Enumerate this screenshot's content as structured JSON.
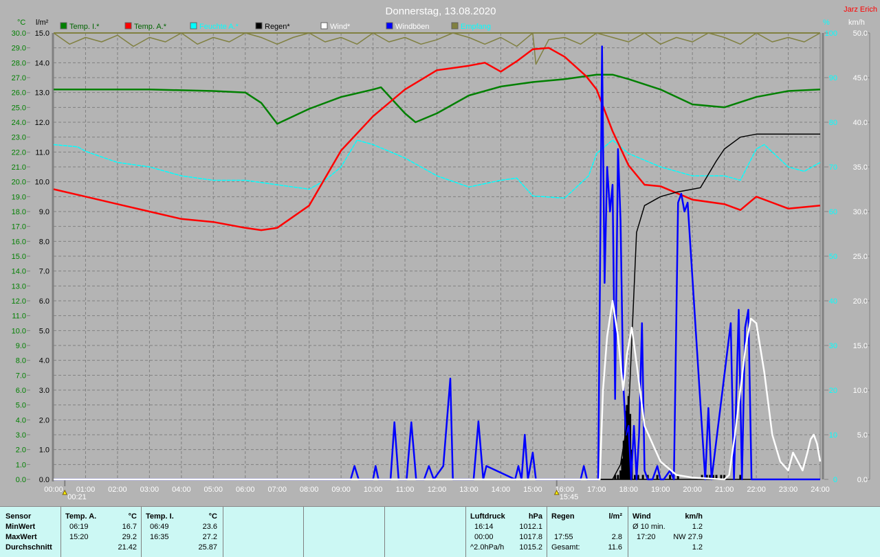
{
  "title": "Donnerstag, 13.08.2020",
  "author": "Jarz Erich",
  "colors": {
    "background": "#b4b4b4",
    "temp_i": "#008000",
    "temp_a": "#ff0000",
    "feuchte": "#00ffff",
    "regen": "#000000",
    "wind": "#ffffff",
    "windboeen": "#0000ff",
    "empfang": "#808040",
    "panel": "#ccf8f4"
  },
  "chart_data": {
    "type": "line",
    "title": "Donnerstag, 13.08.2020",
    "axes": {
      "left_temp": {
        "unit": "°C",
        "range": [
          0,
          30
        ],
        "step": 1
      },
      "left_rain": {
        "unit": "l/m²",
        "range": [
          0,
          15
        ],
        "step": 1
      },
      "right_humidity": {
        "unit": "%",
        "range": [
          0,
          100
        ],
        "step": 10
      },
      "right_wind": {
        "unit": "km/h",
        "range": [
          0,
          50
        ],
        "step": 5
      },
      "x": {
        "unit": "h",
        "range": [
          0,
          24
        ],
        "ticks": [
          "00:00",
          "01:00",
          "02:00",
          "03:00",
          "04:00",
          "05:00",
          "06:00",
          "07:00",
          "08:00",
          "09:00",
          "10:00",
          "11:00",
          "12:00",
          "13:00",
          "14:00",
          "15:00",
          "16:00",
          "17:00",
          "18:00",
          "19:00",
          "20:00",
          "21:00",
          "22:00",
          "23:00",
          "24:00"
        ]
      }
    },
    "grid": true,
    "legend": [
      {
        "label": "Temp. I.*",
        "color": "#008000",
        "text_color": "#006400"
      },
      {
        "label": "Temp. A.*",
        "color": "#ff0000",
        "text_color": "#006400"
      },
      {
        "label": "Feuchte A.*",
        "color": "#00ffff",
        "text_color": "#00ffff"
      },
      {
        "label": "Regen*",
        "color": "#000000",
        "text_color": "#000000"
      },
      {
        "label": "Wind*",
        "color": "#ffffff",
        "text_color": "#ffffff"
      },
      {
        "label": "Windböen",
        "color": "#0000ff",
        "text_color": "#ffffff"
      },
      {
        "label": "Empfang",
        "color": "#808040",
        "text_color": "#00ffff"
      }
    ],
    "annotations": [
      {
        "label": "00:21",
        "x": 0.35
      },
      {
        "label": "15:45",
        "x": 15.75
      }
    ],
    "series": [
      {
        "name": "Temp. I.",
        "axis": "left_temp",
        "color": "#008000",
        "x": [
          0,
          3,
          5,
          6,
          6.5,
          7,
          8,
          9,
          10,
          10.25,
          11,
          11.33,
          12,
          13,
          14,
          15,
          16,
          17,
          17.5,
          18,
          19,
          20,
          21,
          22,
          23,
          24
        ],
        "y": [
          26.2,
          26.2,
          26.1,
          26.0,
          25.3,
          23.9,
          24.9,
          25.7,
          26.2,
          26.35,
          24.6,
          24.0,
          24.6,
          25.8,
          26.4,
          26.7,
          26.9,
          27.2,
          27.2,
          26.9,
          26.2,
          25.2,
          25.0,
          25.7,
          26.1,
          26.2
        ]
      },
      {
        "name": "Temp. A.",
        "axis": "left_temp",
        "color": "#ff0000",
        "x": [
          0,
          1,
          2,
          3,
          4,
          5,
          6,
          6.5,
          7,
          8,
          9,
          10,
          11,
          12,
          13,
          13.5,
          14,
          14.5,
          15,
          15.5,
          16,
          16.67,
          17,
          17.5,
          18,
          18.5,
          19,
          20,
          21,
          21.5,
          22,
          22.5,
          23,
          24
        ],
        "y": [
          19.5,
          19.0,
          18.5,
          18.0,
          17.5,
          17.3,
          16.9,
          16.75,
          16.9,
          18.4,
          22.1,
          24.4,
          26.2,
          27.5,
          27.8,
          28.0,
          27.4,
          28.1,
          28.9,
          29.0,
          28.4,
          27.1,
          26.2,
          23.4,
          21.1,
          19.8,
          19.7,
          18.8,
          18.5,
          18.1,
          19.0,
          18.6,
          18.2,
          18.4
        ]
      },
      {
        "name": "Feuchte A.",
        "axis": "right_humidity",
        "color": "#00ffff",
        "x": [
          0,
          0.75,
          1,
          2,
          3,
          4,
          5,
          6,
          7,
          8,
          8.5,
          9,
          9.5,
          10,
          11,
          12,
          13,
          14,
          14.5,
          15,
          16,
          16.75,
          17,
          17.5,
          18,
          19,
          20,
          21,
          21.5,
          22,
          22.25,
          23,
          23.5,
          24
        ],
        "y": [
          75,
          74.5,
          73.5,
          71,
          70,
          68,
          67,
          67,
          66,
          65,
          67,
          70,
          76,
          75,
          72,
          68,
          65.5,
          67,
          67.5,
          63.5,
          63,
          68,
          73,
          76,
          73,
          70,
          68,
          68,
          67,
          74,
          75,
          70,
          69,
          71
        ]
      },
      {
        "name": "Regen",
        "axis": "left_rain",
        "color": "#000000",
        "x": [
          0,
          17.5,
          17.75,
          18,
          18.25,
          18.5,
          19,
          19.5,
          20,
          20.25,
          20.75,
          21,
          21.5,
          22,
          24
        ],
        "y": [
          0,
          0,
          0.5,
          2.2,
          8.3,
          9.2,
          9.5,
          9.65,
          9.75,
          9.8,
          10.7,
          11.1,
          11.5,
          11.6,
          11.6
        ]
      },
      {
        "name": "Windböen",
        "axis": "right_wind",
        "color": "#0000ff",
        "x": [
          0,
          9.3,
          9.42,
          9.55,
          10,
          10.08,
          10.17,
          10.55,
          10.67,
          10.8,
          11.05,
          11.2,
          11.35,
          11.6,
          11.75,
          11.9,
          12.2,
          12.42,
          12.5,
          13.15,
          13.3,
          13.45,
          13.55,
          14.45,
          14.55,
          14.65,
          14.75,
          14.85,
          15.0,
          15.1,
          16.5,
          16.6,
          16.7,
          17.05,
          17.17,
          17.25,
          17.33,
          17.42,
          17.5,
          17.58,
          17.67,
          17.75,
          17.83,
          17.92,
          18.0,
          18.08,
          18.17,
          18.25,
          18.33,
          18.42,
          18.5,
          18.6,
          18.75,
          18.9,
          19.0,
          19.1,
          19.3,
          19.42,
          19.55,
          19.65,
          19.75,
          19.85,
          20.4,
          20.5,
          20.6,
          21.2,
          21.3,
          21.45,
          21.55,
          21.65,
          21.75,
          21.85,
          21.95,
          22.05,
          22.6,
          22.7,
          22.8,
          22.95,
          23.05,
          23.15,
          23.3,
          23.4,
          23.5,
          23.6,
          23.7,
          23.8,
          23.9,
          24
        ],
        "y": [
          0,
          0,
          1.5,
          0,
          0,
          1.5,
          0,
          0,
          6.4,
          0,
          0,
          6.4,
          0,
          0,
          1.5,
          0,
          1.5,
          11.3,
          0,
          0,
          6.5,
          0,
          1.5,
          0,
          1.5,
          0,
          5,
          0,
          3,
          0,
          0,
          1.5,
          0,
          0,
          48.5,
          22,
          35,
          30,
          33,
          9,
          37,
          29,
          11,
          5,
          6,
          0,
          6,
          0,
          5,
          17.5,
          1,
          0,
          0,
          1.5,
          0,
          0,
          1,
          0,
          31,
          32,
          30,
          31,
          0,
          8,
          0,
          17.5,
          0,
          19,
          0,
          17,
          19,
          0,
          0,
          0,
          0,
          0,
          0,
          0,
          0,
          0,
          0,
          0,
          0,
          0,
          0,
          0,
          0,
          0
        ]
      },
      {
        "name": "Wind",
        "axis": "right_wind",
        "color": "#ffffff",
        "x": [
          0,
          17.1,
          17.2,
          17.33,
          17.5,
          17.67,
          17.83,
          17.95,
          18.1,
          18.25,
          18.5,
          19,
          19.5,
          20,
          21,
          21.15,
          21.33,
          21.5,
          21.67,
          21.83,
          22,
          22.25,
          22.5,
          22.75,
          23,
          23.15,
          23.3,
          23.45,
          23.6,
          23.7,
          23.8,
          23.9,
          24
        ],
        "y": [
          0,
          0,
          10,
          16,
          20,
          16,
          10,
          14,
          17,
          13,
          6,
          2,
          0.5,
          0.2,
          0,
          0.5,
          5,
          10,
          15,
          18,
          17.5,
          12,
          5,
          2,
          1,
          3,
          2,
          1,
          3,
          4.5,
          5,
          4,
          2
        ]
      },
      {
        "name": "Empfang",
        "axis": "right_humidity",
        "color": "#808040",
        "x": [
          0,
          0.5,
          1,
          1.5,
          2,
          2.5,
          3,
          3.5,
          4,
          4.5,
          5,
          5.5,
          6,
          6.5,
          7,
          7.5,
          8,
          8.5,
          9,
          9.5,
          10,
          10.5,
          11,
          11.5,
          12,
          12.5,
          13,
          13.5,
          14,
          14.5,
          15,
          15.1,
          15.5,
          16,
          16.5,
          17,
          17.5,
          18,
          18.5,
          19,
          19.5,
          20,
          20.5,
          21,
          21.5,
          22,
          22.5,
          23,
          23.5,
          24
        ],
        "y": [
          100,
          97.5,
          99,
          98,
          99.5,
          97,
          99,
          98,
          100,
          97.5,
          99,
          98,
          100,
          99,
          97.5,
          99,
          100,
          98,
          99,
          97.5,
          100,
          98,
          99,
          97.5,
          98.5,
          100,
          99,
          97.5,
          99,
          97,
          100,
          93,
          98.5,
          99,
          97.5,
          100,
          99,
          98,
          100,
          97.5,
          99,
          98,
          100,
          99,
          97.5,
          100,
          98,
          99,
          98,
          100
        ]
      }
    ],
    "rain_rate_bars": {
      "axis": "left_rain",
      "x": [
        17.58,
        17.67,
        17.75,
        17.8,
        17.85,
        17.9,
        17.95,
        18.0,
        18.05,
        18.1,
        18.2,
        18.3,
        18.45,
        18.6,
        18.9,
        19.3,
        19.55,
        20.3,
        20.45,
        20.55,
        20.65,
        20.75,
        20.9,
        21.0,
        21.5
      ],
      "y": [
        0.15,
        0.15,
        0.3,
        0.7,
        1.3,
        2.3,
        2.5,
        2.8,
        2.2,
        1.0,
        0.15,
        0.15,
        0.15,
        0.15,
        0.15,
        0.15,
        0.15,
        0.15,
        0.15,
        0.15,
        0.15,
        0.15,
        0.15,
        0.15,
        0.15
      ]
    }
  },
  "stats": {
    "sensor": {
      "label": "Sensor",
      "min": "MinWert",
      "max": "MaxWert",
      "avg": "Durchschnitt"
    },
    "temp_a": {
      "header": "Temp. A.",
      "unit": "°C",
      "min_time": "06:19",
      "min": "16.7",
      "max_time": "15:20",
      "max": "29.2",
      "avg": "21.42"
    },
    "temp_i": {
      "header": "Temp. I.",
      "unit": "°C",
      "min_time": "06:49",
      "min": "23.6",
      "max_time": "16:35",
      "max": "27.2",
      "avg": "25.87"
    },
    "pressure": {
      "header": "Luftdruck",
      "unit": "hPa",
      "min_time": "16:14",
      "min": "1012.1",
      "max_time": "00:00",
      "max": "1017.8",
      "trend": "^2.0hPa/h",
      "current": "1015.2"
    },
    "rain": {
      "header": "Regen",
      "unit": "l/m²",
      "max_time": "17:55",
      "max": "2.8",
      "total_label": "Gesamt:",
      "total": "11.6"
    },
    "wind": {
      "header": "Wind",
      "unit": "km/h",
      "avg_label": "Ø 10 min.",
      "avg": "1.2",
      "max_time": "17:20",
      "max": "NW 27.9",
      "current": "1.2"
    }
  }
}
